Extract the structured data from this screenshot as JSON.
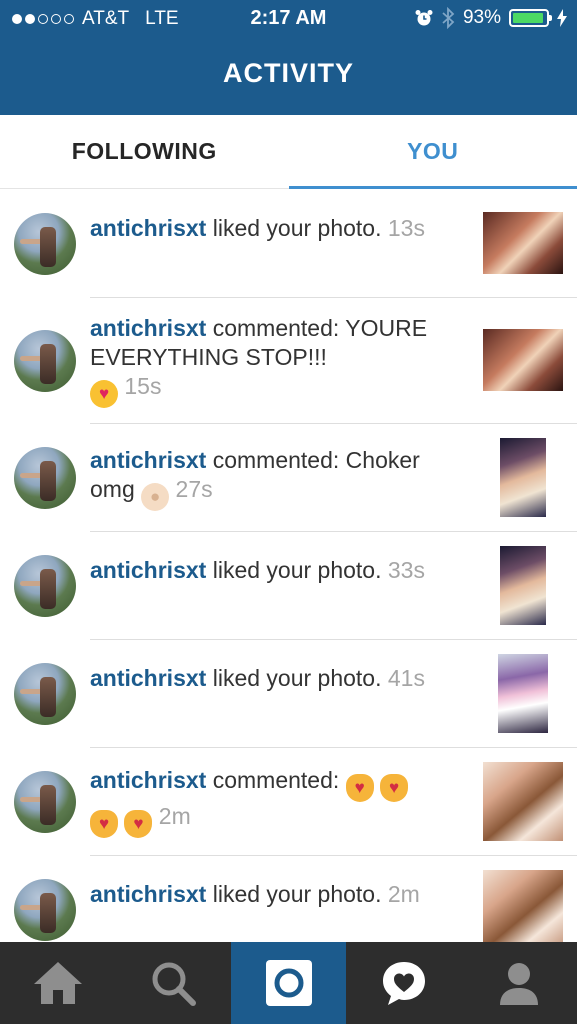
{
  "status": {
    "carrier": "AT&T",
    "network": "LTE",
    "time": "2:17 AM",
    "battery": "93%",
    "battery_level": 0.93
  },
  "header": {
    "title": "ACTIVITY"
  },
  "tabs": [
    {
      "label": "FOLLOWING"
    },
    {
      "label": "YOU"
    }
  ],
  "notifications": [
    {
      "user": "antichrisxt",
      "action": " liked your photo.",
      "time": "13s"
    },
    {
      "user": "antichrisxt",
      "action": " commented: YOURE EVERYTHING STOP!!!",
      "time": "15s"
    },
    {
      "user": "antichrisxt",
      "action": " commented: Choker omg",
      "time": "27s"
    },
    {
      "user": "antichrisxt",
      "action": " liked your photo.",
      "time": "33s"
    },
    {
      "user": "antichrisxt",
      "action": " liked your photo.",
      "time": "41s"
    },
    {
      "user": "antichrisxt",
      "action": " commented:",
      "time": "2m"
    },
    {
      "user": "antichrisxt",
      "action": " liked your photo.",
      "time": "2m"
    }
  ],
  "nav": {
    "items": [
      "home-icon",
      "search-icon",
      "camera-icon",
      "activity-icon",
      "profile-icon"
    ],
    "active_color": "#1c5b8d"
  }
}
